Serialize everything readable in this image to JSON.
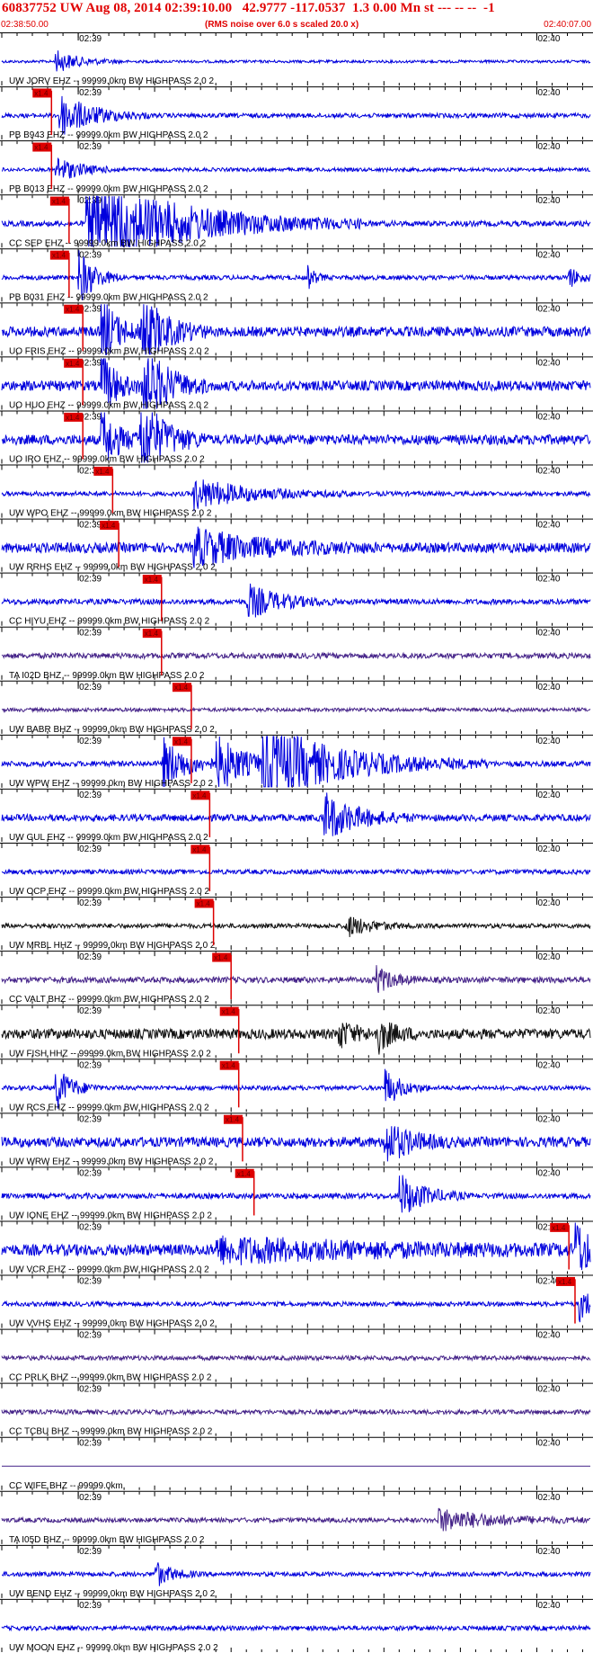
{
  "header": {
    "title": "60837752 UW Aug 08, 2014 02:39:10.00   42.9777 -117.0537  1.3 0.00 Mn st --- -- --  -1",
    "start_time": "02:38:50.00",
    "rms_note": "(RMS noise over 6.0 s scaled 20.0 x)",
    "end_time": "02:40:07.00"
  },
  "colors": {
    "header_text": "#e00000",
    "grid": "#000000",
    "pick": "#dd0000",
    "pick_label_text": "#660000"
  },
  "chart_data": {
    "type": "line",
    "title": "60837752 UW Aug 08, 2014 02:39:10.00   42.9777 -117.0537  1.3 0.00 Mn st --- -- --  -1",
    "x_range": [
      "02:38:50.00",
      "02:40:07.00"
    ],
    "x_ticks": [
      {
        "label": "02:39",
        "time": "02:39:00"
      },
      {
        "label": "02:40",
        "time": "02:40:00"
      }
    ],
    "pick_label": "x1.4",
    "traces": [
      {
        "label": "UW JORV EHZ -- 99999.0km BW  HIGHPASS  2.0  2",
        "color": "#0000dd",
        "pick": null,
        "events": [
          {
            "t": 7,
            "dur": 3,
            "amp": 0.5
          }
        ],
        "noise": 0.06
      },
      {
        "label": "PB B943 EHZ -- 99999.0km BW  HIGHPASS  2.0  2",
        "color": "#0000dd",
        "pick": "02:38:56.5",
        "events": [
          {
            "t": 7.5,
            "dur": 4,
            "amp": 1.0
          }
        ],
        "noise": 0.1
      },
      {
        "label": "PB B013 EHZ -- 99999.0km BW  HIGHPASS  2.0  2",
        "color": "#0000dd",
        "pick": "02:38:56.5",
        "events": [
          {
            "t": 7,
            "dur": 3,
            "amp": 0.6
          }
        ],
        "noise": 0.08
      },
      {
        "label": "CC SEP EHZ -- 99999.0km BW  HIGHPASS  2.0  2",
        "color": "#0000dd",
        "pick": "02:38:58.8",
        "events": [
          {
            "t": 11,
            "dur": 12,
            "amp": 2.2
          }
        ],
        "noise": 0.12
      },
      {
        "label": "PB B031 EHZ -- 99999.0km BW  HIGHPASS  2.0  2",
        "color": "#0000dd",
        "pick": "02:38:58.8",
        "events": [
          {
            "t": 10,
            "dur": 2,
            "amp": 1.3
          },
          {
            "t": 40,
            "dur": 1,
            "amp": 0.5
          },
          {
            "t": 74,
            "dur": 1.5,
            "amp": 0.5
          }
        ],
        "noise": 0.1
      },
      {
        "label": "UO FRIS EHZ -- 99999.0km BW  HIGHPASS  2.0  2",
        "color": "#0000dd",
        "pick": "02:39:00.6",
        "events": [
          {
            "t": 13,
            "dur": 2,
            "amp": 1.6
          },
          {
            "t": 18,
            "dur": 3,
            "amp": 1.8
          }
        ],
        "noise": 0.22
      },
      {
        "label": "UO HUO EHZ -- 99999.0km BW  HIGHPASS  2.0  2",
        "color": "#0000dd",
        "pick": "02:39:00.6",
        "events": [
          {
            "t": 13,
            "dur": 2,
            "amp": 1.4
          },
          {
            "t": 18,
            "dur": 3,
            "amp": 2.2
          }
        ],
        "noise": 0.22
      },
      {
        "label": "UO IRO EHZ -- 99999.0km BW  HIGHPASS  2.0  2",
        "color": "#0000dd",
        "pick": "02:39:00.6",
        "events": [
          {
            "t": 13,
            "dur": 2,
            "amp": 1.4
          },
          {
            "t": 18,
            "dur": 3,
            "amp": 2.0
          }
        ],
        "noise": 0.22
      },
      {
        "label": "UW WPO EHZ -- 99999.0km BW  HIGHPASS  2.0  2",
        "color": "#0000dd",
        "pick": "02:39:04.5",
        "events": [
          {
            "t": 25,
            "dur": 7,
            "amp": 0.7
          }
        ],
        "noise": 0.1
      },
      {
        "label": "UW RRHS EHZ -- 99999.0km BW  HIGHPASS  2.0  2",
        "color": "#0000dd",
        "pick": "02:39:05.3",
        "events": [
          {
            "t": 25,
            "dur": 8,
            "amp": 0.8
          }
        ],
        "noise": 0.22
      },
      {
        "label": "CC HIYU EHZ -- 99999.0km BW  HIGHPASS  2.0  2",
        "color": "#0000dd",
        "pick": "02:39:10.9",
        "events": [
          {
            "t": 32,
            "dur": 4,
            "amp": 0.8
          }
        ],
        "noise": 0.12
      },
      {
        "label": "TA I02D BHZ -- 99999.0km BW  HIGHPASS  2.0  2",
        "color": "#442288",
        "pick": "02:39:10.9",
        "events": [],
        "noise": 0.12
      },
      {
        "label": "UW BABR BHZ -- 99999.0km BW  HIGHPASS  2.0  2",
        "color": "#442288",
        "pick": "02:39:14.8",
        "events": [],
        "noise": 0.08
      },
      {
        "label": "UW WPW EHZ -- 99999.0km BW  HIGHPASS  2.0  2",
        "color": "#0000dd",
        "pick": "02:39:14.8",
        "events": [
          {
            "t": 21,
            "dur": 3,
            "amp": 1.2
          },
          {
            "t": 28,
            "dur": 4,
            "amp": 1.2
          },
          {
            "t": 34,
            "dur": 10,
            "amp": 1.7
          }
        ],
        "noise": 0.12
      },
      {
        "label": "UW GUL EHZ -- 99999.0km BW  HIGHPASS  2.0  2",
        "color": "#0000dd",
        "pick": "02:39:17.2",
        "events": [
          {
            "t": 42,
            "dur": 4,
            "amp": 1.1
          }
        ],
        "noise": 0.15
      },
      {
        "label": "UW OCP EHZ -- 99999.0km BW  HIGHPASS  2.0  2",
        "color": "#0000dd",
        "pick": "02:39:17.2",
        "events": [],
        "noise": 0.1
      },
      {
        "label": "UW MRBL HHZ -- 99999.0km BW  HIGHPASS  2.0  2",
        "color": "#111111",
        "pick": "02:39:17.7",
        "events": [
          {
            "t": 45,
            "dur": 3,
            "amp": 0.5
          }
        ],
        "noise": 0.1
      },
      {
        "label": "CC VALT BHZ -- 99999.0km BW  HIGHPASS  2.0  2",
        "color": "#442288",
        "pick": "02:39:20.0",
        "events": [
          {
            "t": 49,
            "dur": 2,
            "amp": 0.6
          }
        ],
        "noise": 0.13
      },
      {
        "label": "UW FISH HHZ -- 99999.0km BW  HIGHPASS  2.0  2",
        "color": "#111111",
        "pick": "02:39:21.0",
        "events": [
          {
            "t": 44,
            "dur": 2,
            "amp": 0.6
          },
          {
            "t": 49,
            "dur": 2,
            "amp": 0.8
          }
        ],
        "noise": 0.22
      },
      {
        "label": "UW RCS EHZ -- 99999.0km BW  HIGHPASS  2.0  2",
        "color": "#0000dd",
        "pick": "02:39:21.0",
        "events": [
          {
            "t": 7,
            "dur": 2,
            "amp": 1.0
          },
          {
            "t": 50,
            "dur": 2,
            "amp": 0.9
          }
        ],
        "noise": 0.1
      },
      {
        "label": "UW WRW EHZ -- 99999.0km BW  HIGHPASS  2.0  2",
        "color": "#0000dd",
        "pick": "02:39:21.5",
        "events": [
          {
            "t": 50,
            "dur": 3,
            "amp": 1.0
          }
        ],
        "noise": 0.22
      },
      {
        "label": "UW IONE EHZ -- 99999.0km BW  HIGHPASS  2.0  2",
        "color": "#0000dd",
        "pick": "02:39:23.0",
        "events": [
          {
            "t": 52,
            "dur": 3,
            "amp": 1.0
          }
        ],
        "noise": 0.12
      },
      {
        "label": "UW VCR EHZ -- 99999.0km BW  HIGHPASS  2.0  2",
        "color": "#0000dd",
        "pick": "02:40:04.2",
        "events": [
          {
            "t": 28,
            "dur": 20,
            "amp": 0.5
          },
          {
            "t": 75,
            "dur": 2,
            "amp": 1.3
          }
        ],
        "noise": 0.25
      },
      {
        "label": "UW VVHS EHZ -- 99999.0km BW  HIGHPASS  2.0  2",
        "color": "#0000dd",
        "pick": "02:40:05.0",
        "events": [
          {
            "t": 75.5,
            "dur": 1.5,
            "amp": 0.9
          }
        ],
        "noise": 0.1
      },
      {
        "label": "CC PRLK BHZ -- 99999.0km BW  HIGHPASS  2.0  2",
        "color": "#442288",
        "pick": null,
        "events": [],
        "noise": 0.1
      },
      {
        "label": "CC TCBU BHZ -- 99999.0km BW  HIGHPASS  2.0  2",
        "color": "#442288",
        "pick": null,
        "events": [],
        "noise": 0.1
      },
      {
        "label": "CC WIFE BHZ -- 99999.0km",
        "color": "#442288",
        "pick": null,
        "events": [],
        "noise": 0.0
      },
      {
        "label": "TA I05D BHZ -- 99999.0km BW  HIGHPASS  2.0  2",
        "color": "#442288",
        "pick": null,
        "events": [
          {
            "t": 57,
            "dur": 7,
            "amp": 0.5
          }
        ],
        "noise": 0.1
      },
      {
        "label": "UW BEND EHZ -- 99999.0km BW  HIGHPASS  2.0  2",
        "color": "#0000dd",
        "pick": null,
        "events": [
          {
            "t": 20,
            "dur": 2,
            "amp": 0.6
          }
        ],
        "noise": 0.1
      },
      {
        "label": "UW MOON EHZ -- 99999.0km BW  HIGHPASS  2.0  2",
        "color": "#0000dd",
        "pick": null,
        "events": [],
        "noise": 0.1
      }
    ]
  }
}
